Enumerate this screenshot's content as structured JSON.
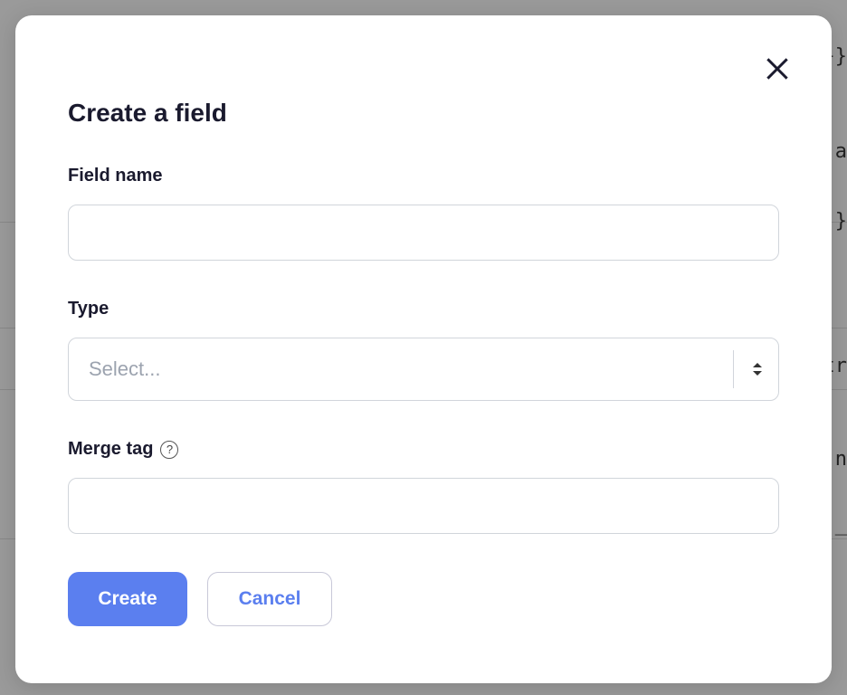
{
  "modal": {
    "title": "Create a field",
    "close_label": "Close",
    "fields": {
      "field_name": {
        "label": "Field name",
        "value": ""
      },
      "type": {
        "label": "Type",
        "placeholder": "Select..."
      },
      "merge_tag": {
        "label": "Merge tag",
        "help": "?",
        "value": ""
      }
    },
    "buttons": {
      "create": "Create",
      "cancel": "Cancel"
    }
  },
  "background_snippets": [
    "}}",
    "a",
    "}",
    "tr",
    "n",
    "_"
  ]
}
